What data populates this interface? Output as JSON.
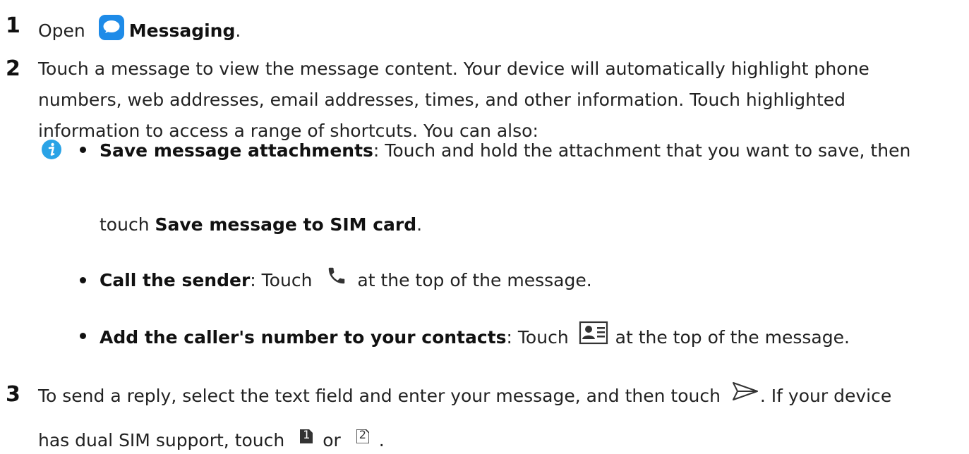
{
  "steps": [
    {
      "number": "1",
      "prefix": "Open",
      "app_name": "Messaging",
      "suffix": "."
    },
    {
      "number": "2",
      "text": "Touch a message to view the message content. Your device will automatically highlight phone numbers, web addresses, email addresses, times, and other information. Touch highlighted information to access a range of shortcuts. You can also:",
      "bullets": [
        {
          "title": "Save message attachments",
          "sep": ": ",
          "text": "Touch and hold the attachment that you want to save, then",
          "text2_prefix": "touch ",
          "text2_bold": "Save message to SIM card",
          "text2_suffix": "."
        },
        {
          "title": "Call the sender",
          "sep": ": ",
          "text_before": "Touch",
          "text_after": "at the top of the message."
        },
        {
          "title": "Add the caller's number to your contacts",
          "sep": ": ",
          "text_before": "Touch",
          "text_after": "at the top of the message."
        }
      ]
    },
    {
      "number": "3",
      "line1_before": "To send a reply, select the text field and enter your message, and then touch",
      "line1_after": ". If your device",
      "line2_before": "has dual SIM support, touch",
      "line2_mid": "or",
      "line2_after": ".",
      "sim1": "1",
      "sim2": "2"
    }
  ],
  "icons": {
    "messaging": "messaging-app-icon",
    "info": "info-icon",
    "phone": "phone-icon",
    "contact_card": "contact-card-icon",
    "send": "send-icon",
    "sim1": "sim-1-icon",
    "sim2": "sim-2-icon"
  },
  "colors": {
    "info_blue": "#2aa3e6",
    "messaging_blue": "#1e8be8",
    "text": "#222222"
  }
}
